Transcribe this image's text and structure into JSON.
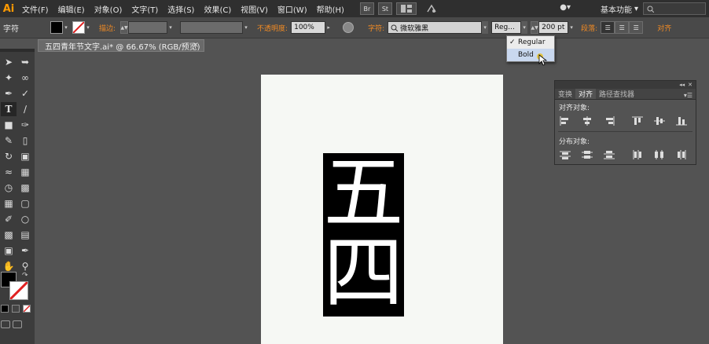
{
  "app": {
    "logo": "Ai"
  },
  "menu": [
    "文件(F)",
    "编辑(E)",
    "对象(O)",
    "文字(T)",
    "选择(S)",
    "效果(C)",
    "视图(V)",
    "窗口(W)",
    "帮助(H)"
  ],
  "toolbar_buttons": {
    "bridge": "Br",
    "stock": "St"
  },
  "workspace": {
    "label": "基本功能",
    "arrow": "▾"
  },
  "controlbar": {
    "panel_label": "字符",
    "stroke_label": "描边:",
    "opacity_label": "不透明度:",
    "opacity_value": "100%",
    "font_label": "字符:",
    "font_value": "微软雅黑",
    "font_style_value": "Reg...",
    "font_size_value": "200 pt",
    "paragraph_label": "段落:",
    "align_label": "对齐"
  },
  "document_tab": {
    "title": "五四青年节文字.ai* @ 66.67% (RGB/预览)",
    "close": "×"
  },
  "artboard": {
    "glyph_top": "五",
    "glyph_bottom": "四"
  },
  "font_style_menu": {
    "options": [
      {
        "label": "Regular",
        "checked": true
      },
      {
        "label": "Bold",
        "checked": false
      }
    ]
  },
  "align_panel": {
    "tabs": [
      "变换",
      "对齐",
      "路径查找器"
    ],
    "active_tab": "对齐",
    "align_objects_label": "对齐对象:",
    "distribute_objects_label": "分布对象:"
  },
  "colors": {
    "accent_orange": "#f08a24",
    "fill_swatch": "#000000",
    "cursor_highlight": "#e7c227"
  }
}
